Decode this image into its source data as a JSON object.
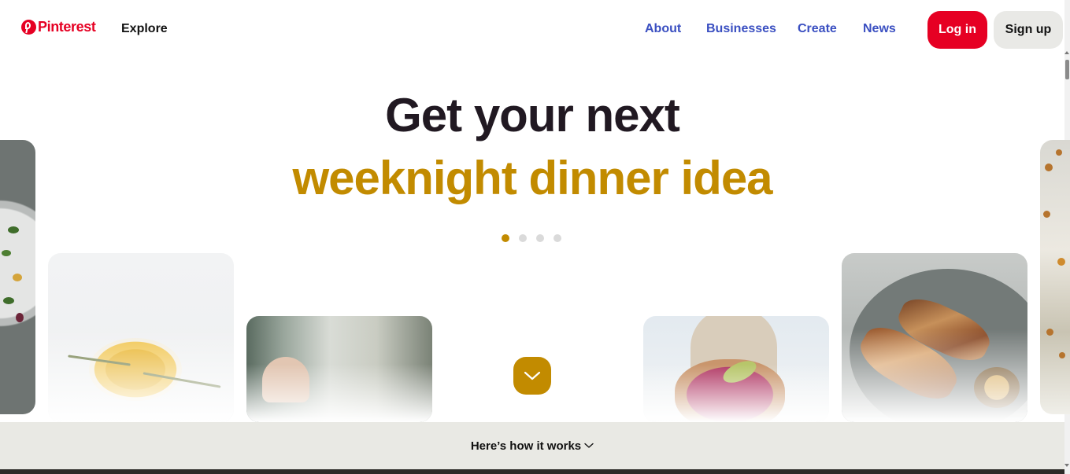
{
  "header": {
    "logo_text": "Pinterest",
    "explore_label": "Explore",
    "nav_links": [
      "About",
      "Businesses",
      "Create",
      "News"
    ],
    "login_label": "Log in",
    "signup_label": "Sign up"
  },
  "hero": {
    "line1": "Get your next",
    "line2": "weeknight dinner idea",
    "carousel_dots": 4,
    "active_dot": 0,
    "accent_color": "#c28b00"
  },
  "footer": {
    "how_it_works_label": "Here’s how it works"
  },
  "colors": {
    "brand_red": "#e60023",
    "nav_link_blue": "#3a4fc1",
    "signup_bg": "#e9e9e6",
    "footer_bg": "#e9e9e4"
  },
  "icons": {
    "logo": "pinterest-logo-icon",
    "scroll_down": "chevron-down-icon",
    "how_it_works": "chevron-down-icon"
  }
}
